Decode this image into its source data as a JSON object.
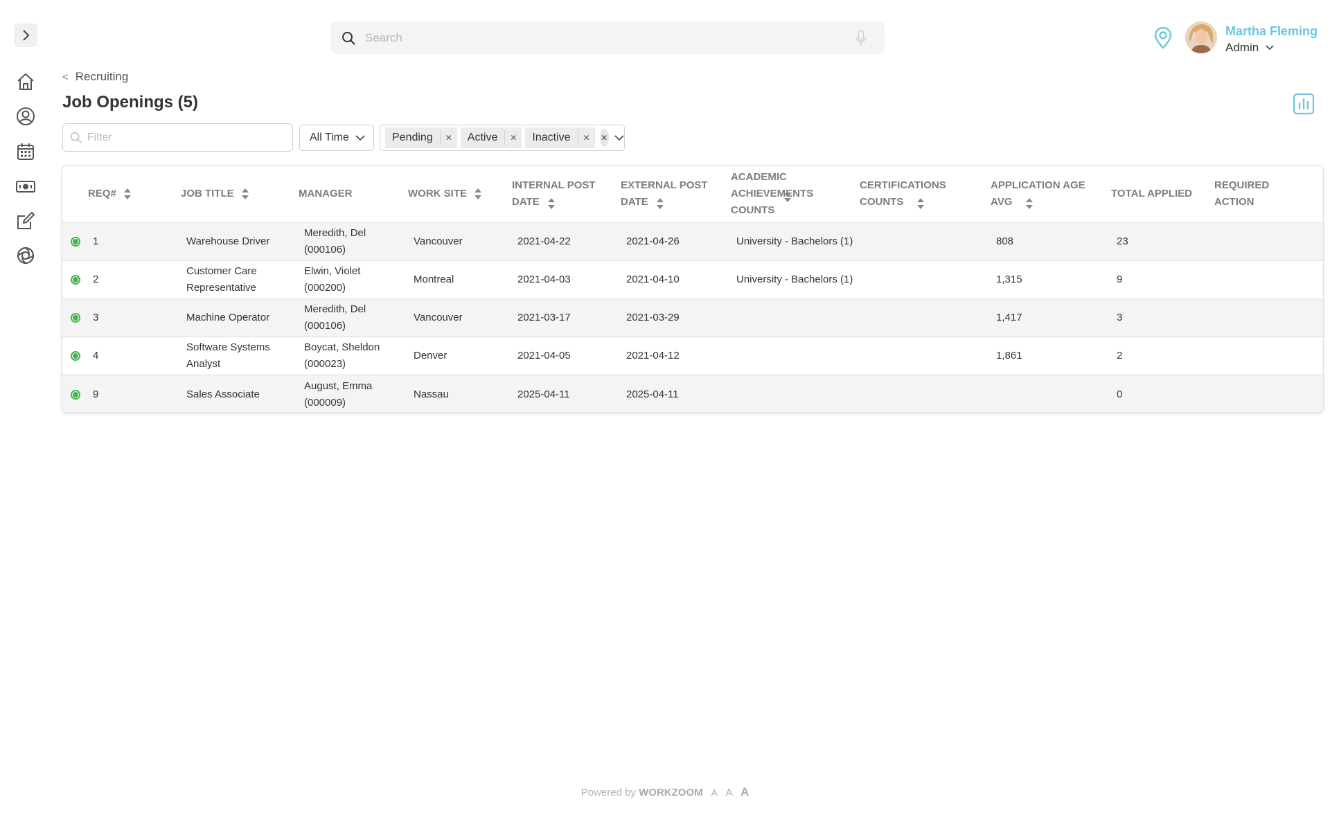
{
  "search": {
    "placeholder": "Search"
  },
  "user": {
    "name": "Martha Fleming",
    "role": "Admin"
  },
  "breadcrumb": {
    "label": "Recruiting"
  },
  "page": {
    "title": "Job Openings (5)"
  },
  "filters": {
    "filter_placeholder": "Filter",
    "time_range": "All Time",
    "status_chips": [
      "Pending",
      "Active",
      "Inactive"
    ]
  },
  "table": {
    "columns": [
      "REQ#",
      "JOB TITLE",
      "MANAGER",
      "WORK SITE",
      "INTERNAL POST DATE",
      "EXTERNAL POST DATE",
      "ACADEMIC ACHIEVEMENTS COUNTS",
      "CERTIFICATIONS COUNTS",
      "APPLICATION AGE AVG",
      "TOTAL APPLIED",
      "REQUIRED ACTION"
    ],
    "rows": [
      {
        "req": "1",
        "job_title": "Warehouse Driver",
        "manager": "Meredith, Del (000106)",
        "work_site": "Vancouver",
        "internal_post_date": "2021-04-22",
        "external_post_date": "2021-04-26",
        "academic": "University - Bachelors (1)",
        "certifications": "",
        "age_avg": "808",
        "total_applied": "23",
        "required_action": ""
      },
      {
        "req": "2",
        "job_title": "Customer Care Representative",
        "manager": "Elwin, Violet (000200)",
        "work_site": "Montreal",
        "internal_post_date": "2021-04-03",
        "external_post_date": "2021-04-10",
        "academic": "University - Bachelors (1)",
        "certifications": "",
        "age_avg": "1,315",
        "total_applied": "9",
        "required_action": ""
      },
      {
        "req": "3",
        "job_title": "Machine Operator",
        "manager": "Meredith, Del (000106)",
        "work_site": "Vancouver",
        "internal_post_date": "2021-03-17",
        "external_post_date": "2021-03-29",
        "academic": "",
        "certifications": "",
        "age_avg": "1,417",
        "total_applied": "3",
        "required_action": ""
      },
      {
        "req": "4",
        "job_title": "Software Systems Analyst",
        "manager": "Boycat, Sheldon (000023)",
        "work_site": "Denver",
        "internal_post_date": "2021-04-05",
        "external_post_date": "2021-04-12",
        "academic": "",
        "certifications": "",
        "age_avg": "1,861",
        "total_applied": "2",
        "required_action": ""
      },
      {
        "req": "9",
        "job_title": "Sales Associate",
        "manager": "August, Emma (000009)",
        "work_site": "Nassau",
        "internal_post_date": "2025-04-11",
        "external_post_date": "2025-04-11",
        "academic": "",
        "certifications": "",
        "age_avg": "",
        "total_applied": "0",
        "required_action": ""
      }
    ]
  },
  "footer": {
    "powered_by": "Powered by",
    "brand": "WORKZOOM",
    "font_sizes": [
      "A",
      "A",
      "A"
    ]
  },
  "colors": {
    "accent": "#6cc6dc",
    "status_active": "#45b54f"
  }
}
